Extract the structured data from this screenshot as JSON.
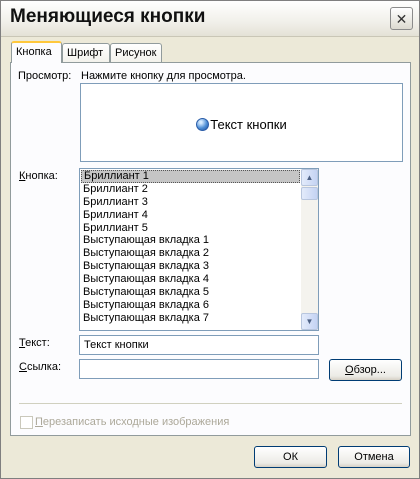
{
  "window": {
    "title": "Меняющиеся кнопки",
    "close_glyph": "✕"
  },
  "tabs": [
    {
      "label": "Кнопка",
      "active": true
    },
    {
      "label": "Шрифт",
      "active": false
    },
    {
      "label": "Рисунок",
      "active": false
    }
  ],
  "preview": {
    "label": "Просмотр:",
    "hint": "Нажмите кнопку для просмотра.",
    "button_text": "Текст кнопки",
    "icon": "orb-button-icon"
  },
  "button_list": {
    "label_first": "К",
    "label_rest": "нопка:",
    "selected_index": 0,
    "items": [
      "Бриллиант 1",
      "Бриллиант 2",
      "Бриллиант 3",
      "Бриллиант 4",
      "Бриллиант 5",
      "Выступающая вкладка 1",
      "Выступающая вкладка 2",
      "Выступающая вкладка 3",
      "Выступающая вкладка 4",
      "Выступающая вкладка 5",
      "Выступающая вкладка 6",
      "Выступающая вкладка 7"
    ],
    "scroll_up_glyph": "▲",
    "scroll_down_glyph": "▼"
  },
  "text_field": {
    "label_first": "Т",
    "label_rest": "екст:",
    "value": "Текст кнопки"
  },
  "link_field": {
    "label_first": "С",
    "label_rest": "сылка:",
    "value": ""
  },
  "browse_button": {
    "label_first": "О",
    "label_rest": "бзор..."
  },
  "overwrite_checkbox": {
    "label_first": "П",
    "label_rest": "ерезаписать исходные изображения",
    "checked": false,
    "enabled": false
  },
  "footer": {
    "ok_label": "ОК",
    "cancel_label": "Отмена"
  }
}
